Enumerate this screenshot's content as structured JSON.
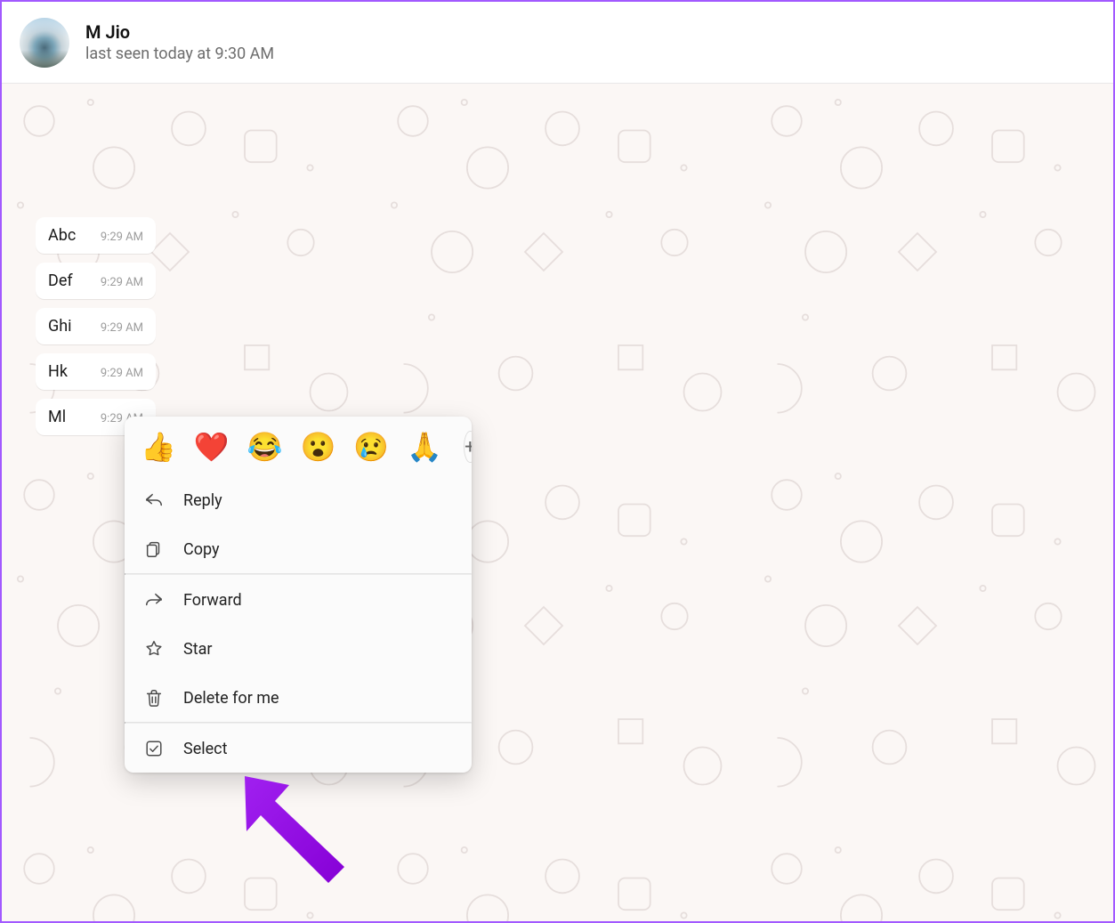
{
  "header": {
    "contact_name": "M Jio",
    "status": "last seen today at 9:30 AM"
  },
  "messages": [
    {
      "text": "Abc",
      "time": "9:29 AM"
    },
    {
      "text": "Def",
      "time": "9:29 AM"
    },
    {
      "text": "Ghi",
      "time": "9:29 AM"
    },
    {
      "text": "Hk",
      "time": "9:29 AM"
    },
    {
      "text": "Ml",
      "time": "9:29 AM"
    }
  ],
  "reactions": {
    "thumbs_up": "👍",
    "heart": "❤️",
    "laugh": "😂",
    "wow": "😮",
    "sad": "😢",
    "pray": "🙏",
    "plus": "+"
  },
  "menu": {
    "reply": "Reply",
    "copy": "Copy",
    "forward": "Forward",
    "star": "Star",
    "delete_for_me": "Delete for me",
    "select": "Select"
  },
  "colors": {
    "annotation_arrow": "#a020f0",
    "border": "#a259ff",
    "chat_bg": "#fbf7f5"
  }
}
